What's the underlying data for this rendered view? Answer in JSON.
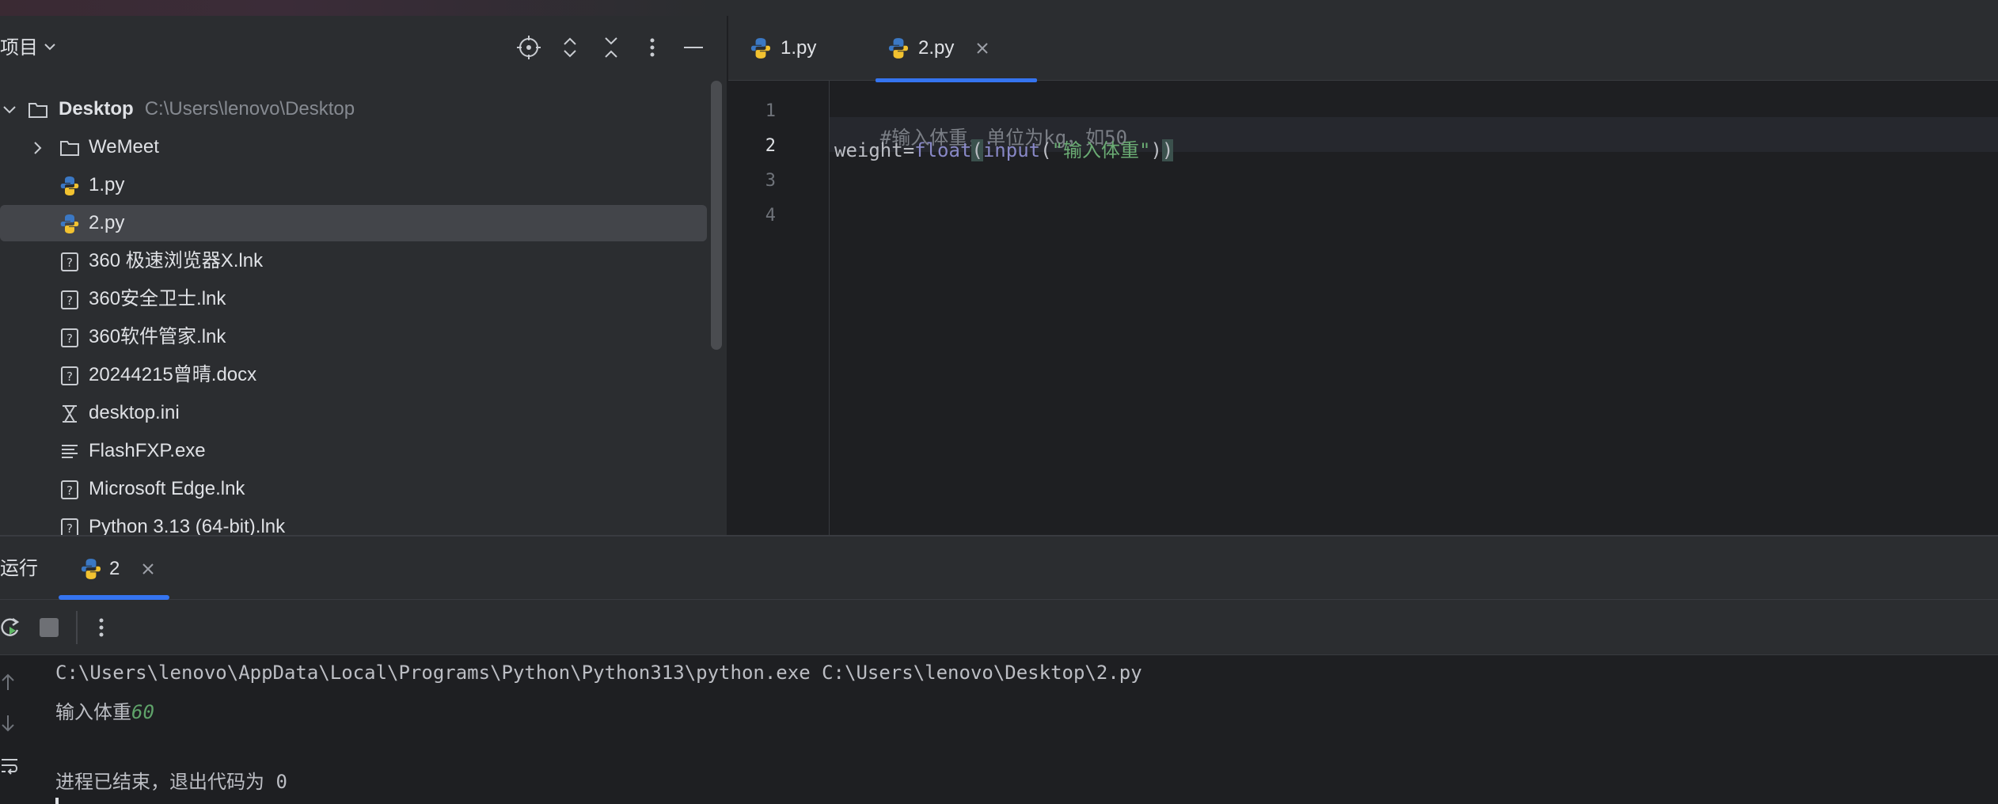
{
  "project_panel": {
    "title": "项目",
    "tree": {
      "root": {
        "name": "Desktop",
        "path": "C:\\Users\\lenovo\\Desktop"
      },
      "items": [
        {
          "name": "WeMeet",
          "kind": "folder"
        },
        {
          "name": "1.py",
          "kind": "python"
        },
        {
          "name": "2.py",
          "kind": "python",
          "selected": true
        },
        {
          "name": "360 极速浏览器X.lnk",
          "kind": "unknown"
        },
        {
          "name": "360安全卫士.lnk",
          "kind": "unknown"
        },
        {
          "name": "360软件管家.lnk",
          "kind": "unknown"
        },
        {
          "name": "20244215曾晴.docx",
          "kind": "unknown"
        },
        {
          "name": "desktop.ini",
          "kind": "ini"
        },
        {
          "name": "FlashFXP.exe",
          "kind": "text"
        },
        {
          "name": "Microsoft Edge.lnk",
          "kind": "unknown"
        },
        {
          "name": "Python 3.13 (64-bit).lnk",
          "kind": "unknown"
        }
      ]
    }
  },
  "editor": {
    "tabs": [
      {
        "label": "1.py"
      },
      {
        "label": "2.py",
        "active": true
      }
    ],
    "line_numbers": [
      "1",
      "2",
      "3",
      "4"
    ],
    "code": {
      "line1_comment": "#输入体重，单位为kg，如50",
      "line2": {
        "var": "weight",
        "eq": "=",
        "fn1": "float",
        "p1": "(",
        "fn2": "input",
        "p2": "(",
        "str": "\"输入体重\"",
        "p3": ")",
        "p4": ")"
      }
    }
  },
  "run_panel": {
    "title": "运行",
    "tab_label": "2",
    "console": {
      "command": "C:\\Users\\lenovo\\AppData\\Local\\Programs\\Python\\Python313\\python.exe C:\\Users\\lenovo\\Desktop\\2.py",
      "prompt": "输入体重",
      "input_value": "60",
      "exit_message": "进程已结束，退出代码为 0"
    }
  },
  "colors": {
    "accent": "#3574f0",
    "panel_bg": "#2b2d30",
    "editor_bg": "#1e1f22",
    "string": "#6aab73",
    "builtin": "#8888c6",
    "comment": "#7a7e85"
  }
}
